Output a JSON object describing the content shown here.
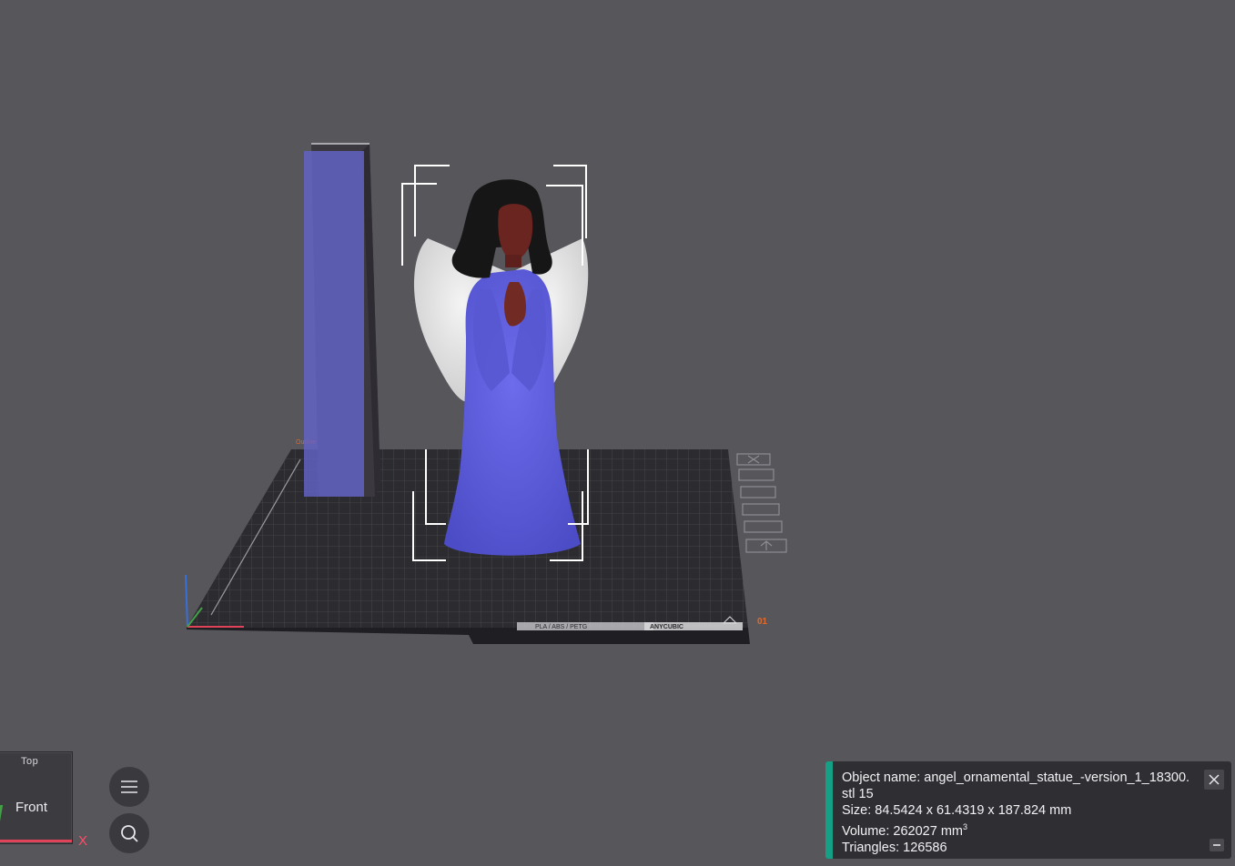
{
  "viewport": {
    "bed_brand": "ANYCUBIC",
    "bed_material": "PLA / ABS / PETG",
    "bed_number": "01",
    "wipe_tower_label": "Outline"
  },
  "view_cube": {
    "top_label": "Top",
    "front_label": "Front",
    "axis_x_label": "X"
  },
  "buttons": {
    "menu_icon": "menu-icon",
    "search_icon": "search-icon"
  },
  "info_panel": {
    "object_name": "Object name: angel_ornamental_statue_-version_1_18300.stl 15",
    "size": "Size: 84.5424 x 61.4319 x 187.824 mm",
    "volume_label": "Volume: 262027 mm",
    "volume_unit_sup": "3",
    "triangles": "Triangles: 126586"
  },
  "colors": {
    "background": "#56565b",
    "accent": "#14a085",
    "model_body": "#5f5fd8",
    "model_hair": "#1a1a1a",
    "model_skin": "#6e2722",
    "model_wings": "#e9e9ea",
    "axis_x": "#e0425a"
  }
}
